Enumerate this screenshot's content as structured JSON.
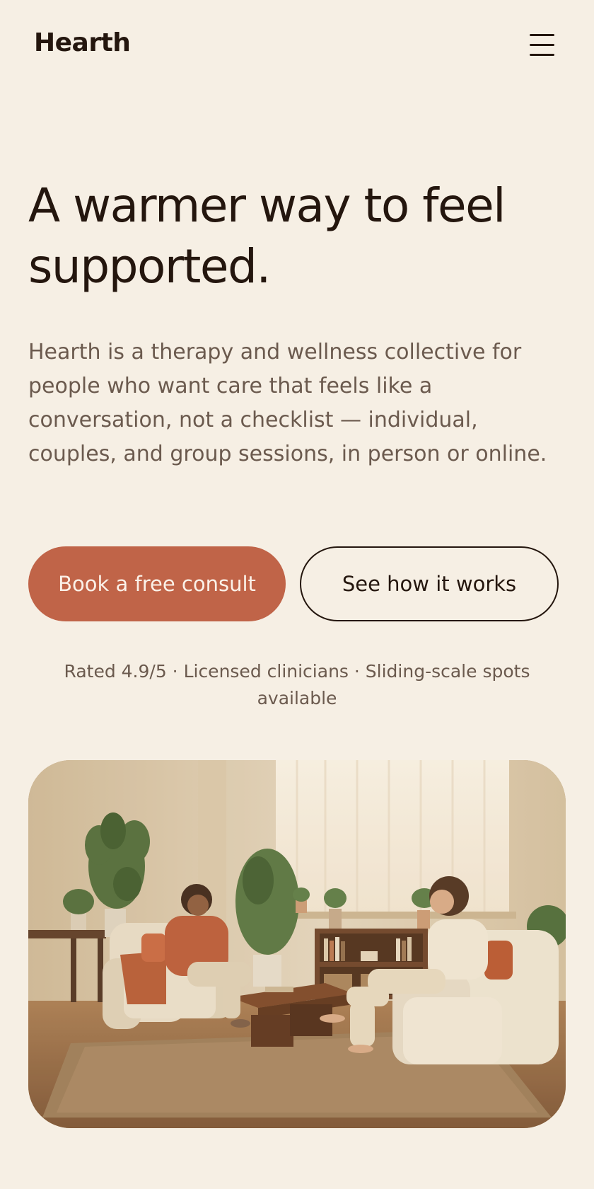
{
  "header": {
    "brand": "Hearth",
    "menu_icon": "hamburger-menu-icon"
  },
  "hero": {
    "headline": "A warmer way to feel supported.",
    "description": "Hearth is a therapy and wellness collective for people who want care that feels like a conversation, not a checklist — individual, couples, and group sessions, in person or online.",
    "primary_cta": "Book a free consult",
    "secondary_cta": "See how it works",
    "trust_line": "Rated 4.9/5 · Licensed clinicians · Sliding-scale spots available"
  },
  "colors": {
    "background": "#f6efe4",
    "text_dark": "#24160e",
    "text_muted": "#6b5a4e",
    "accent": "#c06448"
  }
}
